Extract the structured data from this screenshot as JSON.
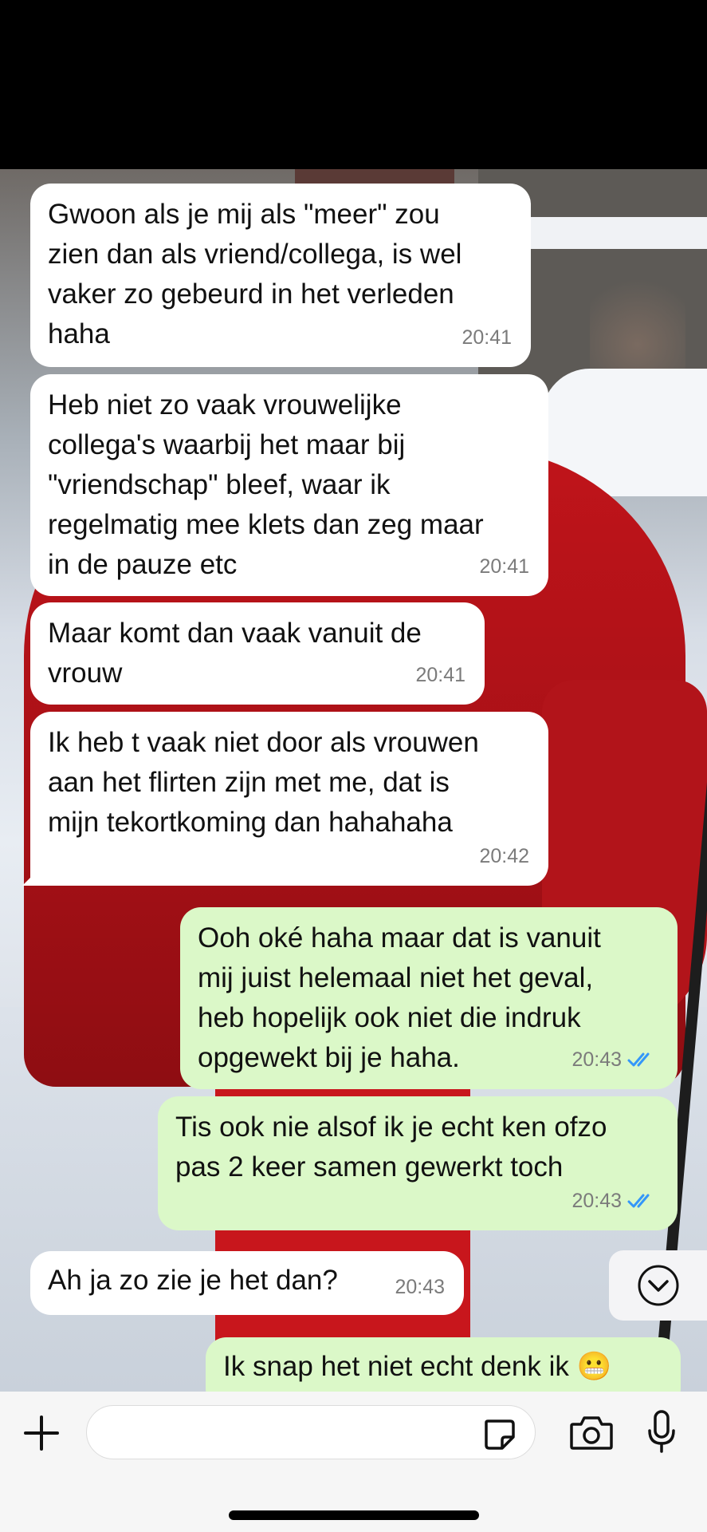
{
  "messages": [
    {
      "direction": "incoming",
      "text": "Gwoon als je mij als \"meer\" zou\nzien dan als vriend/collega, is wel\nvaker zo gebeurd in het verleden\nhaha",
      "time": "20:41"
    },
    {
      "direction": "incoming",
      "text": "Heb niet zo vaak vrouwelijke\ncollega's waarbij het maar bij\n\"vriendschap\" bleef, waar ik\nregelmatig mee klets dan zeg maar\nin de pauze etc",
      "time": "20:41"
    },
    {
      "direction": "incoming",
      "text": "Maar komt dan vaak vanuit de\nvrouw",
      "time": "20:41"
    },
    {
      "direction": "incoming",
      "text": "Ik heb t vaak niet door als vrouwen\naan het flirten zijn met me, dat is\nmijn tekortkoming dan hahahaha",
      "time": "20:42"
    },
    {
      "direction": "outgoing",
      "text": "Ooh oké haha maar dat is vanuit\nmij juist helemaal niet het geval,\nheb hopelijk ook niet die indruk\nopgewekt bij je haha.",
      "time": "20:43",
      "status": "read"
    },
    {
      "direction": "outgoing",
      "text": "Tis ook nie alsof ik je echt ken ofzo\npas 2 keer samen gewerkt toch",
      "time": "20:43",
      "status": "read"
    },
    {
      "direction": "incoming",
      "text": "Ah ja zo zie je het dan?",
      "time": "20:43"
    },
    {
      "direction": "outgoing",
      "text": "Ik snap het niet echt denk ik 😬",
      "time": ""
    }
  ],
  "colors": {
    "incoming_bubble": "#ffffff",
    "outgoing_bubble": "#dbf8c8",
    "read_ticks": "#3497f9",
    "timestamp": "#7b7b7b"
  },
  "composer": {
    "placeholder": "",
    "icons": [
      "plus-icon",
      "sticker-icon",
      "camera-icon",
      "microphone-icon"
    ]
  },
  "scroll_button": {
    "icon": "chevron-down-icon"
  }
}
